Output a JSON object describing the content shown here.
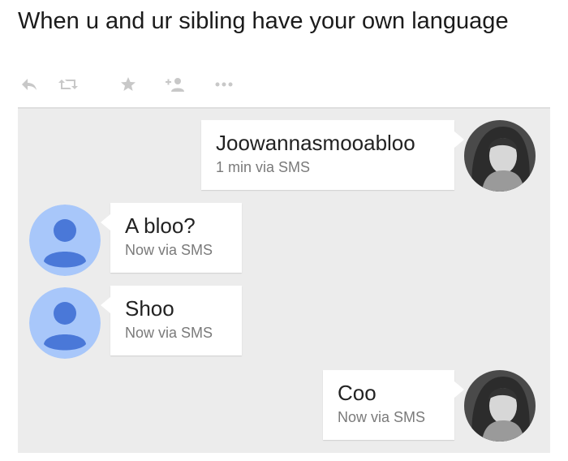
{
  "tweet": {
    "text": "When u and ur sibling have your own language"
  },
  "actions": [
    {
      "icon": "reply-icon"
    },
    {
      "icon": "retweet-icon"
    },
    {
      "icon": "favorite-star-icon"
    },
    {
      "icon": "follow-user-icon"
    },
    {
      "icon": "more-dots-icon"
    }
  ],
  "colors": {
    "chat_background": "#ececec",
    "bubble": "#ffffff",
    "contact_avatar_bg": "#a8c7fa",
    "contact_avatar_fg": "#4a78d8",
    "action_icon": "#c8c8c8"
  },
  "messages": [
    {
      "side": "right",
      "text": "Joowannasmooabloo",
      "meta": "1 min via SMS",
      "avatar": "photo-avatar"
    },
    {
      "side": "left",
      "text": "A bloo?",
      "meta": "Now via SMS",
      "avatar": "contact-avatar-icon"
    },
    {
      "side": "left",
      "text": "Shoo",
      "meta": "Now via SMS",
      "avatar": "contact-avatar-icon"
    },
    {
      "side": "right",
      "text": "Coo",
      "meta": "Now via SMS",
      "avatar": "photo-avatar"
    }
  ]
}
